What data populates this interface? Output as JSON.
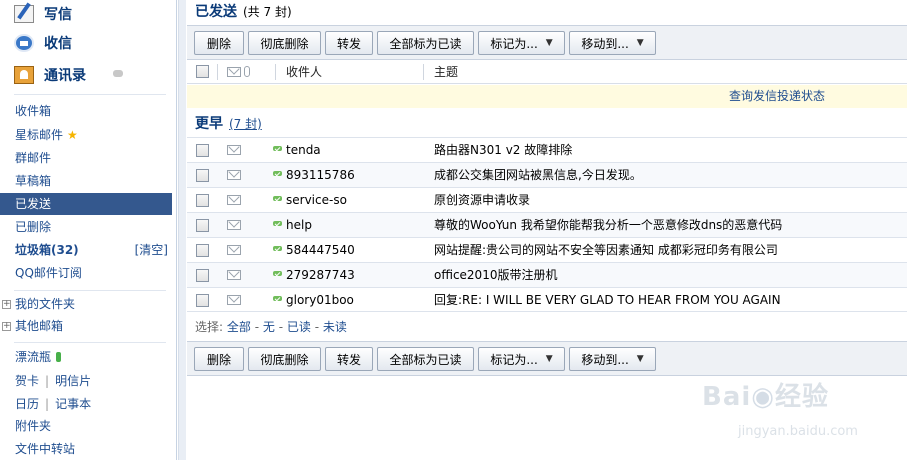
{
  "sidebar": {
    "compose": "写信",
    "inbox_action": "收信",
    "contacts": "通讯录",
    "folders": [
      {
        "label": "收件箱"
      },
      {
        "label": "星标邮件"
      },
      {
        "label": "群邮件"
      },
      {
        "label": "草稿箱"
      },
      {
        "label": "已发送"
      },
      {
        "label": "已删除"
      },
      {
        "label": "垃圾箱(32)"
      },
      {
        "label": "QQ邮件订阅"
      }
    ],
    "clear_label": "[清空]",
    "my_folders": "我的文件夹",
    "other_mailbox": "其他邮箱",
    "drift_bottle": "漂流瓶",
    "greeting_card": "贺卡",
    "postcard": "明信片",
    "calendar": "日历",
    "notebook": "记事本",
    "attachments": "附件夹",
    "file_transfer": "文件中转站"
  },
  "main": {
    "title": "已发送",
    "total": "(共 7 封)",
    "toolbar": {
      "delete": "删除",
      "delete_permanent": "彻底删除",
      "forward": "转发",
      "mark_all_read": "全部标为已读",
      "mark_as": "标记为...",
      "move_to": "移动到..."
    },
    "columns": {
      "recipient": "收件人",
      "subject": "主题"
    },
    "notice_link": "查询发信投递状态",
    "group_label": "更早",
    "group_count": "(7 封)",
    "emails": [
      {
        "recipient": "tenda",
        "subject": "路由器N301 v2 故障排除"
      },
      {
        "recipient": "893115786",
        "subject": "成都公交集团网站被黑信息,今日发现。"
      },
      {
        "recipient": "service-so",
        "subject": "原创资源申请收录"
      },
      {
        "recipient": "help",
        "subject": "尊敬的WooYun 我希望你能帮我分析一个恶意修改dns的恶意代码"
      },
      {
        "recipient": "584447540",
        "subject": "网站提醒:贵公司的网站不安全等因素通知 成都彩冠印务有限公司"
      },
      {
        "recipient": "279287743",
        "subject": "office2010版带注册机"
      },
      {
        "recipient": "glory01boo",
        "subject": "回复:RE: I WILL BE VERY GLAD TO HEAR FROM YOU AGAIN"
      }
    ],
    "select": {
      "prefix": "选择:",
      "all": "全部",
      "none": "无",
      "read": "已读",
      "unread": "未读",
      "sep": "-"
    }
  },
  "watermark": {
    "brand": "Bai",
    "brand2": "经验",
    "url": "jingyan.baidu.com"
  }
}
